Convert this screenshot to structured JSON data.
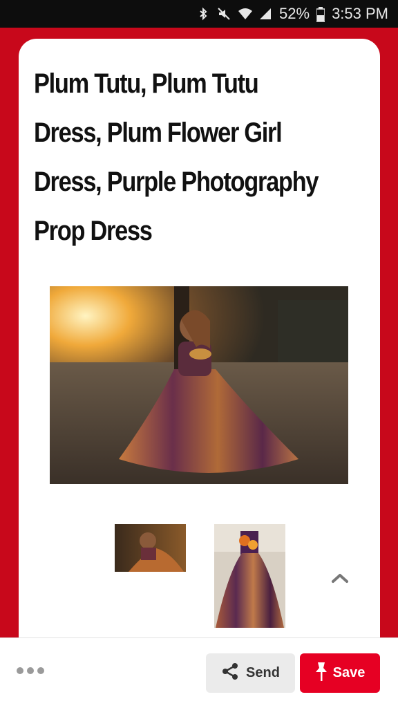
{
  "status_bar": {
    "battery": "52%",
    "time": "3:53 PM",
    "icons": [
      "bluetooth-icon",
      "mute-icon",
      "wifi-icon",
      "signal-icon",
      "battery-icon"
    ]
  },
  "pin": {
    "title": "Plum Tutu, Plum Tutu Dress, Plum Flower Girl Dress, Purple Photography Prop Dress",
    "main_image_alt": "girl in plum tutu dress at sunset",
    "thumbnails": [
      "girl sitting in tutu dress",
      "tutu dress on mannequin"
    ]
  },
  "actions": {
    "more_icon": "more-dots-icon",
    "send_label": "Send",
    "save_label": "Save"
  },
  "colors": {
    "background": "#c8081b",
    "save_button": "#e60023",
    "send_button": "#ebebeb"
  }
}
